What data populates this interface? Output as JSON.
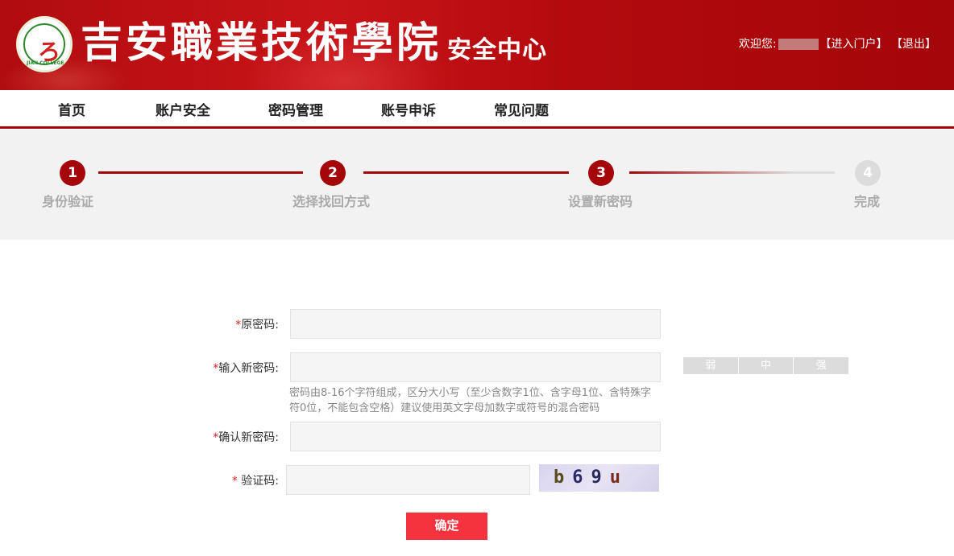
{
  "header": {
    "school_name": "吉安職業技術學院",
    "center_name": "安全中心",
    "welcome": "欢迎您:",
    "portal_link": "【进入门户】",
    "logout_link": "【退出】",
    "logo_text": "JIAN COLLEGE"
  },
  "nav": {
    "items": [
      "首页",
      "账户安全",
      "密码管理",
      "账号申诉",
      "常见问题"
    ]
  },
  "steps": [
    {
      "number": "1",
      "label": "身份验证",
      "state": "done"
    },
    {
      "number": "2",
      "label": "选择找回方式",
      "state": "done"
    },
    {
      "number": "3",
      "label": "设置新密码",
      "state": "current"
    },
    {
      "number": "4",
      "label": "完成",
      "state": "todo"
    }
  ],
  "form": {
    "required_mark": "*",
    "old_password": {
      "label": "原密码:",
      "value": "",
      "placeholder": ""
    },
    "new_password": {
      "label": "输入新密码:",
      "value": "",
      "placeholder": ""
    },
    "hint": "密码由8-16个字符组成，区分大小写（至少含数字1位、含字母1位、含特殊字符0位，不能包含空格）建议使用英文字母加数字或符号的混合密码",
    "strength": [
      "弱",
      "中",
      "强"
    ],
    "confirm_password": {
      "label": "确认新密码:",
      "value": "",
      "placeholder": ""
    },
    "captcha": {
      "label": " 验证码:",
      "value": "",
      "placeholder": "",
      "image_text": [
        "b",
        "6",
        "9",
        "u"
      ]
    },
    "submit_label": "确定"
  },
  "colors": {
    "brand_red": "#a40609",
    "submit_red": "#f5333f",
    "required_red": "#e02020"
  }
}
